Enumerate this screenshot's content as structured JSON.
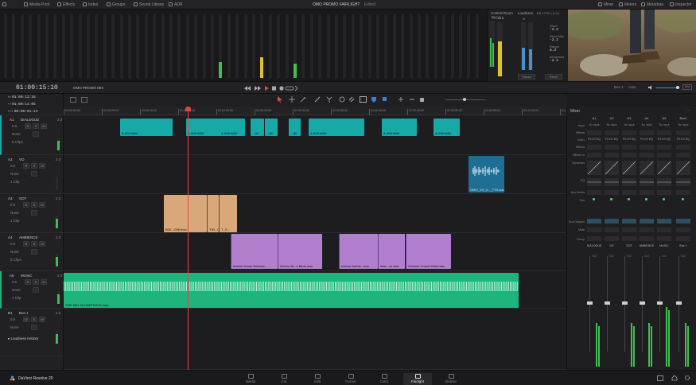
{
  "topbar": {
    "items": [
      {
        "label": "Media Pool",
        "icon": "media-pool-icon"
      },
      {
        "label": "Effects",
        "icon": "effects-icon"
      },
      {
        "label": "Index",
        "icon": "index-icon"
      },
      {
        "label": "Groups",
        "icon": "groups-icon"
      },
      {
        "label": "Sound Library",
        "icon": "sound-library-icon"
      },
      {
        "label": "ADR",
        "icon": "adr-icon"
      }
    ],
    "project_title": "OMO PROMO FAIRLIGHT",
    "project_status": "Edited",
    "right_items": [
      {
        "label": "Mixer",
        "icon": "mixer-icon"
      },
      {
        "label": "Meters",
        "icon": "meters-icon"
      },
      {
        "label": "Metadata",
        "icon": "metadata-icon"
      },
      {
        "label": "Inspector",
        "icon": "inspector-icon"
      }
    ]
  },
  "control_room": {
    "bus_label": "Bus 1",
    "title": "Control Room",
    "tp_label": "TP",
    "tp_value": "-12.5",
    "loudness_title": "Loudness",
    "standard": "BS.1770-1 (LU)",
    "m_label": "M",
    "short_label": "Short",
    "short_value": "-2.2",
    "short_max_label": "Short Max",
    "short_max_value": "-2.2",
    "range_label": "Range",
    "range_value": "8.3",
    "integrated_label": "Integrated",
    "integrated_value": "-2.4",
    "pause_label": "Pause",
    "reset_label": "Reset"
  },
  "transport": {
    "timecode": "01:00:15:10",
    "timeline_name": "OMO PROMO MIX",
    "bus_select": "Bus 1",
    "auto_label": "Auto",
    "dim_label": "DIM"
  },
  "timecodes": {
    "in": "01:00:12:16",
    "out": "01:00:14:05",
    "duration": "00:00:01:13"
  },
  "ruler": {
    "ticks": [
      "01:00:00:00",
      "01:00:05:00",
      "01:00:10:00",
      "01:00:15:00",
      "01:00:20:00",
      "01:00:25:00",
      "01:00:30:00",
      "01:00:35:00",
      "01:00:40:00",
      "01:00:45:00",
      "01:00:50:00",
      "01:00:55:00",
      "01:01:00:00",
      "01:01:05:00"
    ]
  },
  "tracks": [
    {
      "id": "A1",
      "name": "DIALOGUE",
      "vol": "0.0",
      "routing": "None",
      "clips_count": "6 Clips",
      "level": "2.0"
    },
    {
      "id": "A2",
      "name": "VO",
      "vol": "0.0",
      "routing": "None",
      "clips_count": "1 Clip",
      "level": "2.0"
    },
    {
      "id": "A3",
      "name": "SOT",
      "vol": "0.0",
      "routing": "None",
      "clips_count": "1 Clip",
      "level": "2.0"
    },
    {
      "id": "A4",
      "name": "AMBIENCE",
      "vol": "0.0",
      "routing": "None",
      "clips_count": "5 Clips",
      "level": "2.0"
    },
    {
      "id": "A5",
      "name": "MUSIC",
      "vol": "0.0",
      "routing": "None",
      "clips_count": "1 Clip",
      "level": "2.0"
    },
    {
      "id": "B1",
      "name": "Bus 1",
      "vol": "0.0",
      "routing": "None",
      "clips_count": "",
      "level": "2.0"
    }
  ],
  "loudness_history_label": "Loudness History",
  "clips": {
    "a1": [
      "A-002.WAV",
      "A-008.WAV",
      "A-008.WAV",
      "...AV",
      "...AV",
      "...AV",
      "A-008.WAV",
      "A-008.WAV",
      "A-008.WAV"
    ],
    "a2": [
      "OMO_VO_0..._TTS.wav"
    ],
    "a3": [
      "B00...O08.mov",
      "T00...00",
      "T...E..."
    ],
    "a4": [
      "Interior Home Window...",
      "Interior At...e Birds.wav",
      "Interior Ambie...wav",
      "Inter...ce.wav",
      "Outdoor Crowd Walla.wav"
    ],
    "a5": [
      "ONE MIN SOUNDTRACK.wav"
    ]
  },
  "mixer": {
    "title": "Mixer",
    "channels": [
      "A1",
      "A2",
      "A3",
      "A4",
      "A5",
      "Bus1"
    ],
    "row_labels": [
      "Input",
      "Effects",
      "Order",
      "Effects",
      "Effects In",
      "Dynamics",
      "EQ",
      "Bus Sends",
      "Pan",
      "Bus Outputs",
      "Mute",
      "Group"
    ],
    "input_values": [
      "No Input",
      "No Input",
      "No Input",
      "No Input",
      "No Input",
      "No Input"
    ],
    "order_values": [
      "FX DY EQ",
      "FX DY EQ",
      "FX DY EQ",
      "FX DY EQ",
      "FX DY EQ",
      "FX DY EQ"
    ],
    "strip_names": [
      "DIALOGUE",
      "VO",
      "SOT",
      "AMBIENCE",
      "MUSIC",
      "Bus 1"
    ],
    "strip_values": [
      "0.0",
      "0.0",
      "0.0",
      "0.0",
      "0.0",
      "0.0"
    ]
  },
  "app": {
    "name": "DaVinci Resolve 20"
  },
  "pages": [
    {
      "label": "Media",
      "icon": "media-page-icon"
    },
    {
      "label": "Cut",
      "icon": "cut-page-icon"
    },
    {
      "label": "Edit",
      "icon": "edit-page-icon"
    },
    {
      "label": "Fusion",
      "icon": "fusion-page-icon"
    },
    {
      "label": "Color",
      "icon": "color-page-icon"
    },
    {
      "label": "Fairlight",
      "icon": "fairlight-page-icon",
      "active": true
    },
    {
      "label": "Deliver",
      "icon": "deliver-page-icon"
    }
  ],
  "colors": {
    "dialogue": "#16a9a8",
    "vo": "#1f6f95",
    "sot": "#d9a878",
    "ambience": "#b27fcf",
    "music": "#1fb47d",
    "playhead": "#e0483f",
    "meter_green": "#3fbf4f",
    "meter_yellow": "#d9c22a",
    "meter_blue": "#4a8fd0"
  }
}
